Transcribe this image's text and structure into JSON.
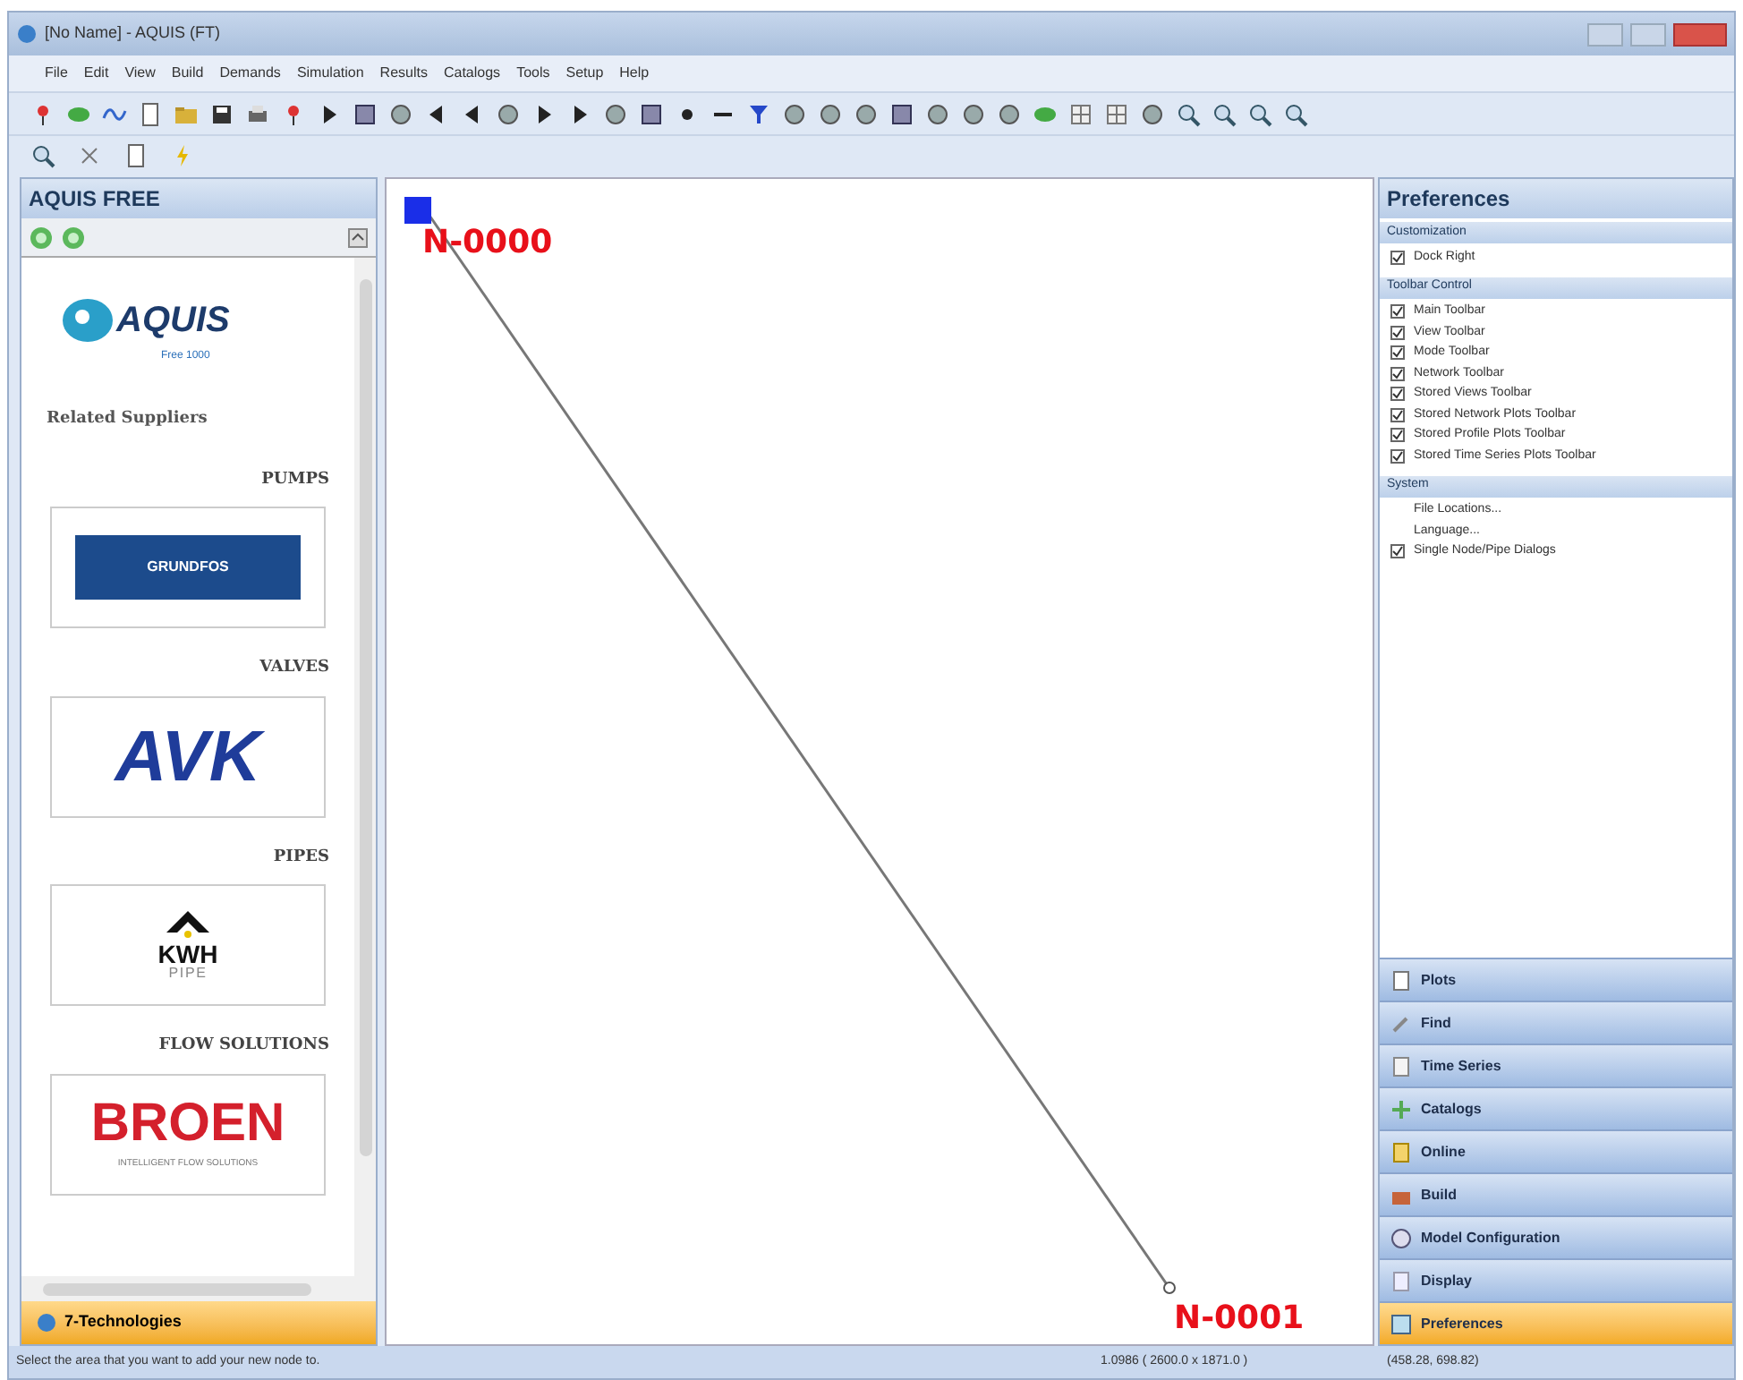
{
  "window": {
    "title": "[No Name] - AQUIS (FT)"
  },
  "menu": [
    "File",
    "Edit",
    "View",
    "Build",
    "Demands",
    "Simulation",
    "Results",
    "Catalogs",
    "Tools",
    "Setup",
    "Help"
  ],
  "left_panel": {
    "title": "AQUIS FREE",
    "logo": {
      "name": "AQUIS",
      "edition": "Free 1000"
    },
    "heading": "Related Suppliers",
    "suppliers": [
      {
        "category": "PUMPS",
        "kind": "grundfos",
        "logo_text": "GRUNDFOS"
      },
      {
        "category": "VALVES",
        "kind": "avk",
        "logo_text": "AVK"
      },
      {
        "category": "PIPES",
        "kind": "kwh",
        "logo_text": "KWH",
        "logo_subtext": "PIPE"
      },
      {
        "category": "FLOW SOLUTIONS",
        "kind": "broen",
        "logo_text": "BROEN",
        "logo_subtext": "INTELLIGENT FLOW SOLUTIONS"
      }
    ],
    "tab": {
      "label": "7-Technologies",
      "selected": true
    }
  },
  "canvas": {
    "nodes": [
      {
        "label": "N-0000",
        "kind": "square"
      },
      {
        "label": "N-0001",
        "kind": "circle"
      }
    ]
  },
  "preferences": {
    "title": "Preferences",
    "sections": [
      {
        "title": "Customization",
        "items": [
          {
            "label": "Dock Right",
            "kind": "checkbox",
            "checked": true
          }
        ]
      },
      {
        "title": "Toolbar Control",
        "items": [
          {
            "label": "Main Toolbar",
            "kind": "checkbox",
            "checked": true
          },
          {
            "label": "View Toolbar",
            "kind": "checkbox",
            "checked": true
          },
          {
            "label": "Mode Toolbar",
            "kind": "checkbox",
            "checked": true
          },
          {
            "label": "Network Toolbar",
            "kind": "checkbox",
            "checked": true
          },
          {
            "label": "Stored Views Toolbar",
            "kind": "checkbox",
            "checked": true
          },
          {
            "label": "Stored Network Plots Toolbar",
            "kind": "checkbox",
            "checked": true
          },
          {
            "label": "Stored Profile Plots Toolbar",
            "kind": "checkbox",
            "checked": true
          },
          {
            "label": "Stored Time Series Plots Toolbar",
            "kind": "checkbox",
            "checked": true
          }
        ]
      },
      {
        "title": "System",
        "items": [
          {
            "label": "File Locations...",
            "kind": "command"
          },
          {
            "label": "Language...",
            "kind": "command"
          },
          {
            "label": "Single Node/Pipe Dialogs",
            "kind": "checkbox",
            "checked": true
          }
        ]
      }
    ]
  },
  "nav_buttons": [
    {
      "label": "Plots",
      "selected": false
    },
    {
      "label": "Find",
      "selected": false
    },
    {
      "label": "Time Series",
      "selected": false
    },
    {
      "label": "Catalogs",
      "selected": false
    },
    {
      "label": "Online",
      "selected": false
    },
    {
      "label": "Build",
      "selected": false
    },
    {
      "label": "Model Configuration",
      "selected": false
    },
    {
      "label": "Display",
      "selected": false
    },
    {
      "label": "Preferences",
      "selected": true
    }
  ],
  "status_bar": {
    "message": "Select the area that you want to add your new node to.",
    "scale": "1.0986 ( 2600.0 x 1871.0 )",
    "coordinates": "(458.28, 698.82)"
  }
}
